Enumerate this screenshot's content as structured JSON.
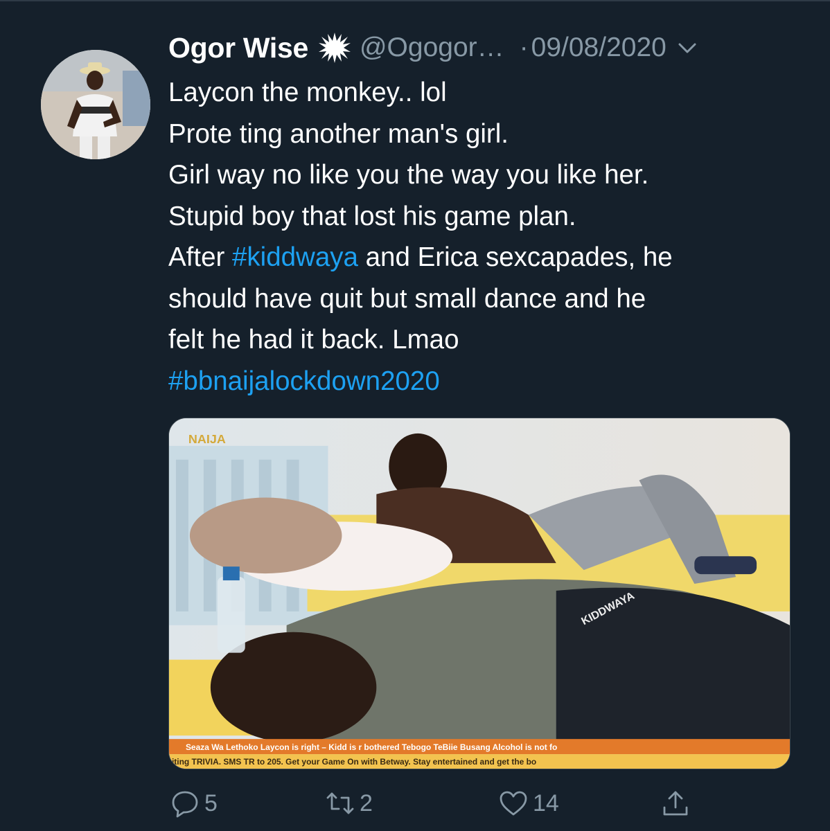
{
  "tweet": {
    "author": {
      "display_name": "Ogor Wise",
      "handle": "@Ogogor…",
      "verified_icon": "explosion-badge-icon"
    },
    "separator": "·",
    "timestamp": "09/08/2020",
    "lines": [
      [
        {
          "text": "Laycon the monkey.. lol",
          "hashtag": false
        }
      ],
      [
        {
          "text": "Prote ting another man's girl.",
          "hashtag": false
        }
      ],
      [
        {
          "text": "Girl way no like you the way you like her.",
          "hashtag": false
        }
      ],
      [
        {
          "text": "Stupid boy that lost his game plan.",
          "hashtag": false
        }
      ],
      [
        {
          "text": "After ",
          "hashtag": false
        },
        {
          "text": "#kiddwaya",
          "hashtag": true
        },
        {
          "text": " and Erica sexcapades, he",
          "hashtag": false
        }
      ],
      [
        {
          "text": "should have quit but small dance and he",
          "hashtag": false
        }
      ],
      [
        {
          "text": "felt he had it back. Lmao",
          "hashtag": false
        }
      ],
      [
        {
          "text": "#bbnaijalockdown2020",
          "hashtag": true
        }
      ]
    ],
    "media": {
      "watermark": "NAIJA",
      "shirt_text": "KIDDWAYA",
      "ticker_line_1": "Seaza Wa Lethoko Laycon is right – Kidd is r bothered   Tebogo TeBiie Busang Alcohol is not fo",
      "ticker_line_2": "iting TRIVIA. SMS TR to 205. Get your Game On with Betway.   Stay entertained and get the bo"
    },
    "actions": {
      "reply_count": "5",
      "retweet_count": "2",
      "like_count": "14"
    }
  },
  "colors": {
    "background": "#15202b",
    "text": "#ffffff",
    "secondary": "#8899a6",
    "link": "#1da1f2"
  }
}
